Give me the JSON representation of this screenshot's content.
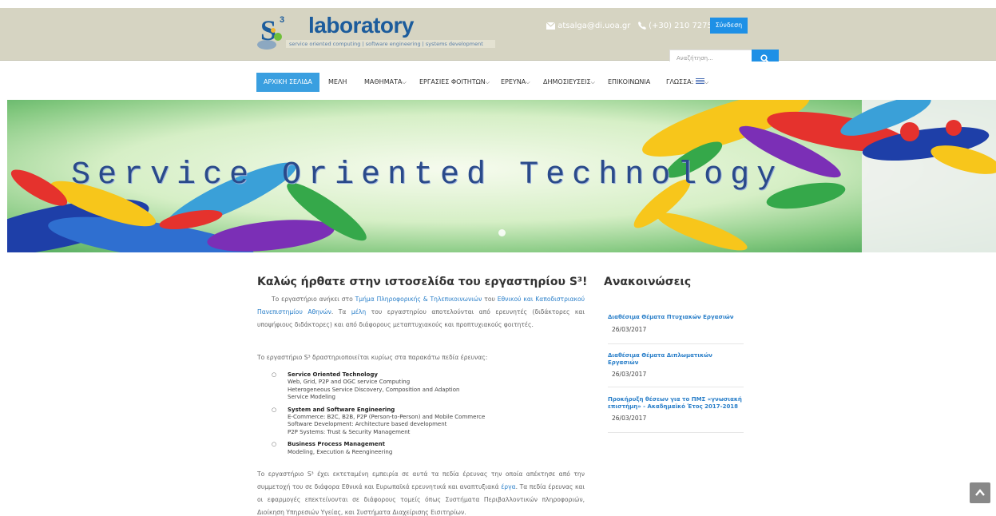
{
  "header": {
    "logo_text": "laboratory",
    "logo_tagline": "service oriented computing | software engineering | systems development",
    "email": "atsalga@di.uoa.gr",
    "phone": "(+30) 210 7275206",
    "login_label": "Σύνδεση",
    "search_placeholder": "Αναζήτηση...",
    "colors": {
      "header_bg": "#d6d4c2",
      "accent": "#1e90e6"
    }
  },
  "nav": {
    "items": [
      {
        "label": "ΑΡΧΙΚΗ ΣΕΛΙΔΑ",
        "active": true
      },
      {
        "label": "ΜΕΛΗ"
      },
      {
        "label": "ΜΑΘΗΜΑΤΑ",
        "dropdown": true
      },
      {
        "label": "ΕΡΓΑΣΙΕΣ ΦΟΙΤΗΤΩΝ",
        "dropdown": true
      },
      {
        "label": "ΕΡΕΥΝΑ",
        "dropdown": true
      },
      {
        "label": "ΔΗΜΟΣΙΕΥΣΕΙΣ",
        "dropdown": true
      },
      {
        "label": "ΕΠΙΚΟΙΝΩΝΙΑ"
      },
      {
        "label": "ΓΛΩΣΣΑ:",
        "dropdown": true,
        "icon": "greek-flag-icon"
      }
    ]
  },
  "hero": {
    "title": "Service Oriented Technology"
  },
  "main": {
    "title": "Καλώς ήρθατε στην ιστοσελίδα του εργαστηρίου S³!",
    "intro": {
      "t1": "Το εργαστήριο ανήκει στο ",
      "l1": "Τμήμα Πληροφορικής & Τηλεπικοινωνιών",
      "t2": " του ",
      "l2": "Εθνικού και Καποδιστριακού Πανεπιστημίου Αθηνών",
      "t3": ". Τα ",
      "l3": "μέλη",
      "t4": " του εργαστηρίου αποτελούνται από ερευνητές (διδάκτορες και υποψήφιους διδάκτορες) και από διάφορους μεταπτυχιακούς και προπτυχιακούς φοιτητές."
    },
    "areas_intro": "Το εργαστήριο S³ δραστηριοποιείται κυρίως στα παρακάτω πεδία έρευνας:",
    "areas": [
      {
        "title": "Service Oriented Technology",
        "lines": [
          "Web, Grid, P2P and OGC service Computing",
          "Heterogeneous Service Discovery, Composition and Adaption",
          "Service Modeling"
        ]
      },
      {
        "title": "System and Software Engineering",
        "lines": [
          "E-Commerce: B2C, B2B, P2P (Person-to-Person) and Mobile Commerce",
          "Software Development: Architecture based development",
          "P2P Systems: Trust & Security Management"
        ]
      },
      {
        "title": "Business Process Management",
        "lines": [
          "Modeling, Execution & Reengineering"
        ]
      }
    ],
    "closing": {
      "t1": "Το εργαστήριο S³ έχει εκτεταμένη εμπειρία σε αυτά τα πεδία έρευνας την οποία απέκτησε από την συμμετοχή του σε διάφορα Εθνικά και Ευρωπαϊκά ερευνητικά και αναπτυξιακά ",
      "l1": "έργα",
      "t2": ". Τα πεδία έρευνας και οι εφαρμογές επεκτείνονται σε διάφορους τομείς όπως Συστήματα Περιβαλλοντικών πληροφοριών, Διοίκηση Υπηρεσιών Υγείας, και Συστήματα Διαχείρισης Εισιτηρίων."
    }
  },
  "announcements": {
    "title": "Ανακοινώσεις",
    "items": [
      {
        "title": "Διαθέσιμα Θέματα Πτυχιακών Εργασιών",
        "date": "26/03/2017"
      },
      {
        "title": "Διαθέσιμα Θέματα Διπλωματικών Εργασιών",
        "date": "26/03/2017"
      },
      {
        "title": "Προκήρυξη θέσεων για το ΠΜΣ «γνωσιακή επιστήμη» - Ακαδημαϊκό Έτος 2017-2018",
        "date": "26/03/2017"
      }
    ]
  }
}
